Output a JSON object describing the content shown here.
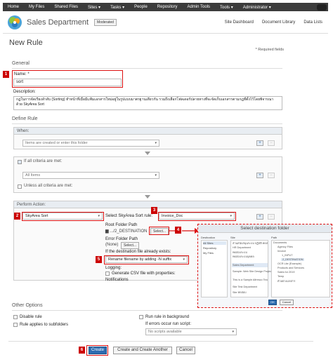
{
  "topnav": {
    "items": [
      "Home",
      "My Files",
      "Shared Files",
      "Sites ▾",
      "Tasks ▾",
      "People",
      "Repository",
      "Admin Tools",
      "Tools ▾",
      "Administrator ▾"
    ]
  },
  "site": {
    "title": "Sales Department",
    "badge": "Moderated",
    "links": [
      "Site Dashboard",
      "Document Library",
      "Data Lists"
    ]
  },
  "page": {
    "title": "New Rule",
    "required_note": "* Required fields"
  },
  "general": {
    "heading": "General",
    "name_label": "Name: *",
    "name_value": "sort",
    "description_label": "Description:",
    "description_value": "กฎในการจัดเรียงลำดับ (Sorting) ทำหน้าที่เมื่อมีแฟ้มเอกสารใหม่อยู่ในรูปแบบมาตรฐานเดียวกัน รวมถึงเลือกโฟลเดอร์ปลายทางที่จะจัดเก็บเอกสารตามกฎที่ตั้งไว้โดยพิจารณาด้วย SkyArea Sort"
  },
  "define": {
    "heading": "Define Rule",
    "when_label": "When:",
    "when_select": "Items are created or enter this folder",
    "if_all_label": "If all criteria are met:",
    "if_all_select": "All Items",
    "unless_label": "Unless all criteria are met:",
    "perform_label": "Perform Action:",
    "action_select": "SkyArea Sort",
    "sort_rule_label": "Select SkyArea Sort rule:",
    "sort_rule_value": "Invoice_Doc",
    "root_folder_label": "Root Folder Path",
    "root_folder_value": "▆ .../2_DESTINATION",
    "select_btn": "Select...",
    "error_folder_label": "Error Folder Path",
    "error_folder_value": "(None)",
    "exists_label": "If the destination file already exists:",
    "exists_value": "Rename filename by adding -N suffix",
    "logging_label": "Logging:",
    "csv_label": "Generate CSV file with properties:",
    "notifications_label": "Notifications"
  },
  "popup": {
    "title": "Select destination folder",
    "col_destination": "Destination",
    "col_site": "Site",
    "col_path": "Path",
    "destinations": [
      "All Sites",
      "Repository",
      "My Files"
    ],
    "sites": [
      "ส่วนสนับสนุนระบบ ปฏิบัติ ทดสอบระบบเครือข่ายหนึ่ง",
      "HR Department",
      "ทดสอบระบบ",
      "ทดสอบระบบบุคคล",
      "Sales Department",
      "Sample: Web Site Design Project",
      "This is a Sample Alfresco Team site.",
      "Site Test Department",
      "Site ทดสอบ"
    ],
    "paths": [
      "Documents",
      "Agency Files",
      "Invoice",
      "1_INPUT",
      "2_DESTINATION",
      "OCR Lite (Example)",
      "Products and Services",
      "Sales for 2019",
      "Temp",
      "ตัวอย่างเอกสาร"
    ],
    "ok": "OK",
    "cancel": "Cancel"
  },
  "other": {
    "heading": "Other Options",
    "disable_rule": "Disable rule",
    "applies_subfolders": "Rule applies to subfolders",
    "run_background": "Run rule in background",
    "errors_label": "If errors occur run script:",
    "errors_select": "No scripts available"
  },
  "buttons": {
    "create": "Create",
    "create_another": "Create and Create Another",
    "cancel": "Cancel"
  },
  "markers": [
    "1",
    "2",
    "3",
    "4",
    "5",
    "6"
  ],
  "colors": {
    "accent": "#2d6cb0",
    "marker": "#cc0000",
    "topnav": "#3c3c3c"
  }
}
